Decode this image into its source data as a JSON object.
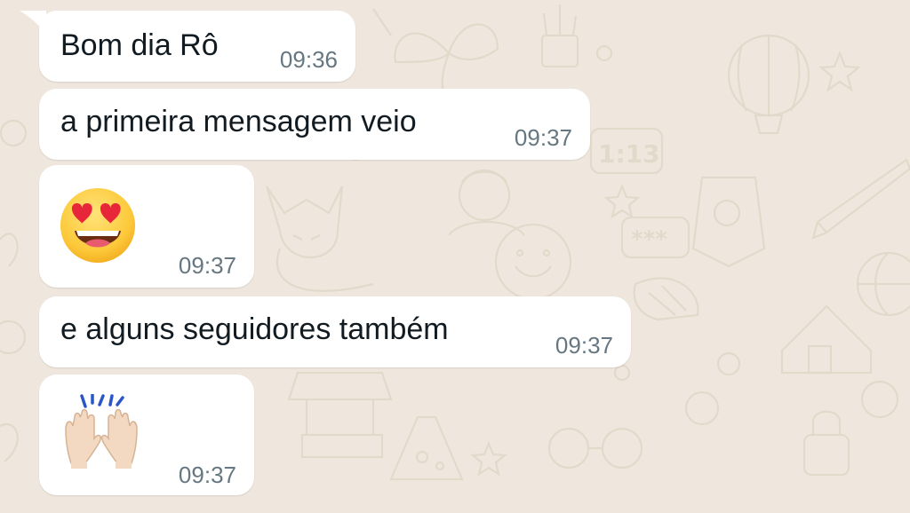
{
  "messages": [
    {
      "type": "text",
      "text": "Bom dia Rô",
      "time": "09:36"
    },
    {
      "type": "text",
      "text": "a primeira mensagem veio",
      "time": "09:37"
    },
    {
      "type": "emoji",
      "emoji": "smiling-face-with-heart-eyes",
      "time": "09:37"
    },
    {
      "type": "text",
      "text": "e alguns seguidores também",
      "time": "09:37"
    },
    {
      "type": "emoji",
      "emoji": "raising-hands-light-skin-tone",
      "time": "09:37"
    }
  ],
  "wallpaper": {
    "clock_text": "1:13",
    "password_text": "***"
  },
  "colors": {
    "background": "#EFE7DD",
    "bubble": "#FFFFFF",
    "text": "#111B21",
    "timestamp": "#667781"
  }
}
